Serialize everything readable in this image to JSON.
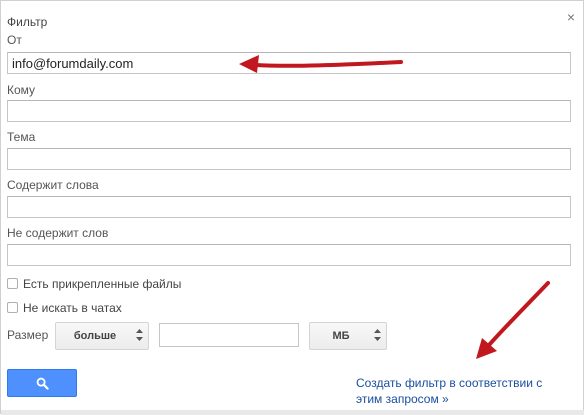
{
  "dialog": {
    "title": "Фильтр",
    "close_glyph": "×"
  },
  "fields": {
    "from_label": "От",
    "from_value": "info@forumdaily.com",
    "to_label": "Кому",
    "to_value": "",
    "subject_label": "Тема",
    "subject_value": "",
    "has_words_label": "Содержит слова",
    "has_words_value": "",
    "no_words_label": "Не содержит слов",
    "no_words_value": ""
  },
  "checkboxes": {
    "has_attachments_label": "Есть прикрепленные файлы",
    "has_attachments_checked": false,
    "no_chats_label": "Не искать в чатах",
    "no_chats_checked": false
  },
  "size": {
    "label": "Размер",
    "comparator": "больше",
    "value": "",
    "unit": "МБ"
  },
  "actions": {
    "search_icon": "search-icon",
    "create_filter_link": "Создать фильтр в соответствии с этим запросом »"
  },
  "colors": {
    "primary_button": "#4d90fe",
    "link": "#1a4fa0",
    "annotation_arrow": "#c0181e"
  }
}
